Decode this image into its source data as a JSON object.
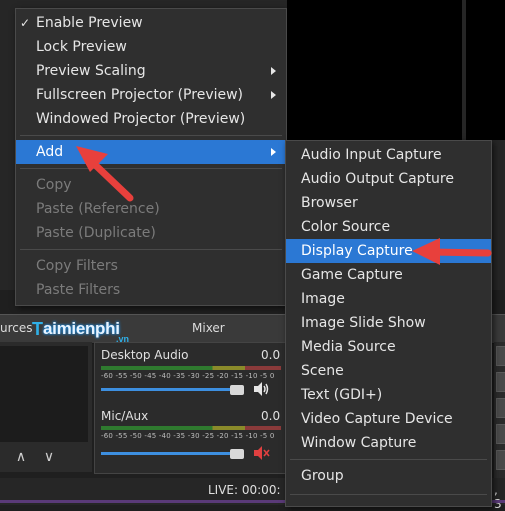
{
  "main_menu": {
    "items": [
      {
        "label": "Enable Preview",
        "checked": true,
        "disabled": false,
        "submenu": false
      },
      {
        "label": "Lock Preview",
        "checked": false,
        "disabled": false,
        "submenu": false
      },
      {
        "label": "Preview Scaling",
        "checked": false,
        "disabled": false,
        "submenu": true
      },
      {
        "label": "Fullscreen Projector (Preview)",
        "checked": false,
        "disabled": false,
        "submenu": true
      },
      {
        "label": "Windowed Projector (Preview)",
        "checked": false,
        "disabled": false,
        "submenu": false
      },
      {
        "label": "Add",
        "checked": false,
        "disabled": false,
        "submenu": true,
        "highlighted": true
      },
      {
        "label": "Copy",
        "disabled": true
      },
      {
        "label": "Paste (Reference)",
        "disabled": true
      },
      {
        "label": "Paste (Duplicate)",
        "disabled": true
      },
      {
        "label": "Copy Filters",
        "disabled": true
      },
      {
        "label": "Paste Filters",
        "disabled": true
      }
    ],
    "check_mark": "✓"
  },
  "add_submenu": {
    "items": [
      {
        "label": "Audio Input Capture"
      },
      {
        "label": "Audio Output Capture"
      },
      {
        "label": "Browser"
      },
      {
        "label": "Color Source"
      },
      {
        "label": "Display Capture",
        "highlighted": true
      },
      {
        "label": "Game Capture"
      },
      {
        "label": "Image"
      },
      {
        "label": "Image Slide Show"
      },
      {
        "label": "Media Source"
      },
      {
        "label": "Scene"
      },
      {
        "label": "Text (GDI+)"
      },
      {
        "label": "Video Capture Device"
      },
      {
        "label": "Window Capture"
      },
      {
        "label": "Group"
      }
    ]
  },
  "docks": {
    "sources_title": "urces",
    "mixer_title": "Mixer"
  },
  "watermark": {
    "t": "T",
    "rest": "aimienphi",
    "vn": ".vn"
  },
  "mixer": {
    "channels": [
      {
        "name": "Desktop Audio",
        "db": "0.0",
        "muted": false
      },
      {
        "name": "Mic/Aux",
        "db": "0.0",
        "muted": true
      }
    ],
    "ticks": "-60 -55 -50 -45 -40 -35 -30 -25 -20 -15 -10 -5 0"
  },
  "sources_controls": {
    "up": "∧",
    "down": "∨"
  },
  "status": {
    "live": "LIVE: 00:00:",
    "tail": ", 3"
  },
  "colors": {
    "highlight": "#2b78d4",
    "arrow_red": "#e8403c"
  }
}
